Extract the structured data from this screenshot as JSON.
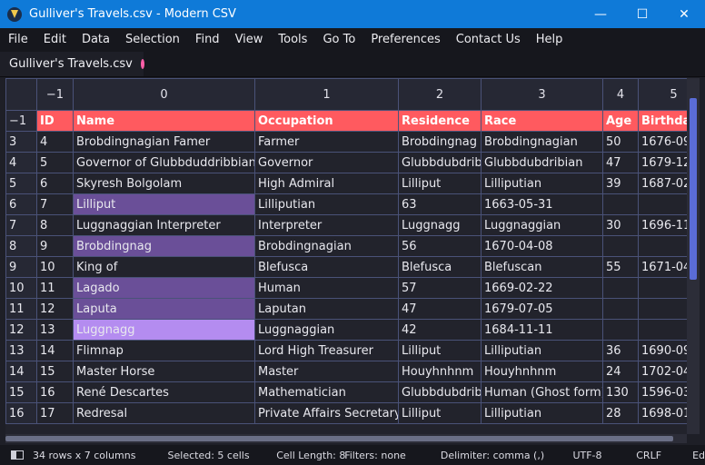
{
  "window": {
    "title": "Gulliver's Travels.csv - Modern CSV",
    "minimize": "—",
    "maximize": "☐",
    "close": "✕"
  },
  "menu": [
    "File",
    "Edit",
    "Data",
    "Selection",
    "Find",
    "View",
    "Tools",
    "Go To",
    "Preferences",
    "Contact Us",
    "Help"
  ],
  "tab": {
    "label": "Gulliver's Travels.csv"
  },
  "grid": {
    "corner": "",
    "col_numbers": [
      "−1",
      "0",
      "1",
      "2",
      "3",
      "4",
      "5"
    ],
    "header_row_number": "−1",
    "headers": [
      "ID",
      "Name",
      "Occupation",
      "Residence",
      "Race",
      "Age",
      "Birthdate"
    ],
    "rows": [
      {
        "n": "3",
        "cells": [
          "4",
          "Brobdingnagian Famer",
          "Farmer",
          "Brobdingnag",
          "Brobdingnagian",
          "50",
          "1676-09-"
        ]
      },
      {
        "n": "4",
        "cells": [
          "5",
          "Governor of Glubbduddribbian",
          "Governor",
          "Glubbdubdrib",
          "Glubbdubdribian",
          "47",
          "1679-12-"
        ]
      },
      {
        "n": "5",
        "cells": [
          "6",
          "Skyresh Bolgolam",
          "High Admiral",
          "Lilliput",
          "Lilliputian",
          "39",
          "1687-02-"
        ]
      },
      {
        "n": "6",
        "cells": [
          "7",
          "Lilliput",
          "Lilliputian",
          "63",
          "1663-05-31",
          "",
          ""
        ]
      },
      {
        "n": "7",
        "cells": [
          "8",
          "Luggnaggian Interpreter",
          "Interpreter",
          "Luggnagg",
          "Luggnaggian",
          "30",
          "1696-11-"
        ]
      },
      {
        "n": "8",
        "cells": [
          "9",
          "Brobdingnag",
          "Brobdingnagian",
          "56",
          "1670-04-08",
          "",
          ""
        ]
      },
      {
        "n": "9",
        "cells": [
          "10",
          "King of",
          "Blefusca",
          "Blefusca",
          "Blefuscan",
          "55",
          "1671-04-"
        ]
      },
      {
        "n": "10",
        "cells": [
          "11",
          "Lagado",
          "Human",
          "57",
          "1669-02-22",
          "",
          ""
        ]
      },
      {
        "n": "11",
        "cells": [
          "12",
          "Laputa",
          "Laputan",
          "47",
          "1679-07-05",
          "",
          ""
        ]
      },
      {
        "n": "12",
        "cells": [
          "13",
          "Luggnagg",
          "Luggnaggian",
          "42",
          "1684-11-11",
          "",
          ""
        ]
      },
      {
        "n": "13",
        "cells": [
          "14",
          "Flimnap",
          "Lord High Treasurer",
          "Lilliput",
          "Lilliputian",
          "36",
          "1690-09-"
        ]
      },
      {
        "n": "14",
        "cells": [
          "15",
          "Master Horse",
          "Master",
          "Houyhnhnm",
          "Houyhnhnm",
          "24",
          "1702-04-"
        ]
      },
      {
        "n": "15",
        "cells": [
          "16",
          "René Descartes",
          "Mathematician",
          "Glubbdubdrib",
          "Human (Ghost form)",
          "130",
          "1596-03-"
        ]
      },
      {
        "n": "16",
        "cells": [
          "17",
          "Redresal",
          "Private Affairs Secretary",
          "Lilliput",
          "Lilliputian",
          "28",
          "1698-01-"
        ]
      }
    ]
  },
  "colors": {
    "titlebar": "#0f7ad8",
    "header_row": "#ff5a5f",
    "selection": "#6a4f98",
    "selection_active": "#b48cf0",
    "tab_dot": "#ff5fa8"
  },
  "status": {
    "dimensions": "34 rows x 7 columns",
    "selected": "Selected: 5 cells",
    "cell_length": "Cell Length: 8",
    "filters": "Filters: none",
    "delimiter": "Delimiter: comma (,)",
    "encoding": "UTF-8",
    "line_ending": "CRLF",
    "overflow": "Ed"
  }
}
